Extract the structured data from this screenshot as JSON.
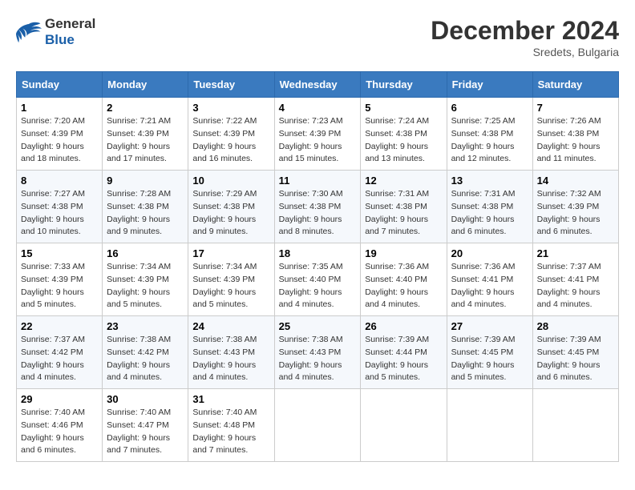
{
  "header": {
    "logo_line1": "General",
    "logo_line2": "Blue",
    "month_title": "December 2024",
    "location": "Sredets, Bulgaria"
  },
  "weekdays": [
    "Sunday",
    "Monday",
    "Tuesday",
    "Wednesday",
    "Thursday",
    "Friday",
    "Saturday"
  ],
  "weeks": [
    [
      {
        "day": "1",
        "sunrise": "7:20 AM",
        "sunset": "4:39 PM",
        "daylight": "9 hours and 18 minutes."
      },
      {
        "day": "2",
        "sunrise": "7:21 AM",
        "sunset": "4:39 PM",
        "daylight": "9 hours and 17 minutes."
      },
      {
        "day": "3",
        "sunrise": "7:22 AM",
        "sunset": "4:39 PM",
        "daylight": "9 hours and 16 minutes."
      },
      {
        "day": "4",
        "sunrise": "7:23 AM",
        "sunset": "4:39 PM",
        "daylight": "9 hours and 15 minutes."
      },
      {
        "day": "5",
        "sunrise": "7:24 AM",
        "sunset": "4:38 PM",
        "daylight": "9 hours and 13 minutes."
      },
      {
        "day": "6",
        "sunrise": "7:25 AM",
        "sunset": "4:38 PM",
        "daylight": "9 hours and 12 minutes."
      },
      {
        "day": "7",
        "sunrise": "7:26 AM",
        "sunset": "4:38 PM",
        "daylight": "9 hours and 11 minutes."
      }
    ],
    [
      {
        "day": "8",
        "sunrise": "7:27 AM",
        "sunset": "4:38 PM",
        "daylight": "9 hours and 10 minutes."
      },
      {
        "day": "9",
        "sunrise": "7:28 AM",
        "sunset": "4:38 PM",
        "daylight": "9 hours and 9 minutes."
      },
      {
        "day": "10",
        "sunrise": "7:29 AM",
        "sunset": "4:38 PM",
        "daylight": "9 hours and 9 minutes."
      },
      {
        "day": "11",
        "sunrise": "7:30 AM",
        "sunset": "4:38 PM",
        "daylight": "9 hours and 8 minutes."
      },
      {
        "day": "12",
        "sunrise": "7:31 AM",
        "sunset": "4:38 PM",
        "daylight": "9 hours and 7 minutes."
      },
      {
        "day": "13",
        "sunrise": "7:31 AM",
        "sunset": "4:38 PM",
        "daylight": "9 hours and 6 minutes."
      },
      {
        "day": "14",
        "sunrise": "7:32 AM",
        "sunset": "4:39 PM",
        "daylight": "9 hours and 6 minutes."
      }
    ],
    [
      {
        "day": "15",
        "sunrise": "7:33 AM",
        "sunset": "4:39 PM",
        "daylight": "9 hours and 5 minutes."
      },
      {
        "day": "16",
        "sunrise": "7:34 AM",
        "sunset": "4:39 PM",
        "daylight": "9 hours and 5 minutes."
      },
      {
        "day": "17",
        "sunrise": "7:34 AM",
        "sunset": "4:39 PM",
        "daylight": "9 hours and 5 minutes."
      },
      {
        "day": "18",
        "sunrise": "7:35 AM",
        "sunset": "4:40 PM",
        "daylight": "9 hours and 4 minutes."
      },
      {
        "day": "19",
        "sunrise": "7:36 AM",
        "sunset": "4:40 PM",
        "daylight": "9 hours and 4 minutes."
      },
      {
        "day": "20",
        "sunrise": "7:36 AM",
        "sunset": "4:41 PM",
        "daylight": "9 hours and 4 minutes."
      },
      {
        "day": "21",
        "sunrise": "7:37 AM",
        "sunset": "4:41 PM",
        "daylight": "9 hours and 4 minutes."
      }
    ],
    [
      {
        "day": "22",
        "sunrise": "7:37 AM",
        "sunset": "4:42 PM",
        "daylight": "9 hours and 4 minutes."
      },
      {
        "day": "23",
        "sunrise": "7:38 AM",
        "sunset": "4:42 PM",
        "daylight": "9 hours and 4 minutes."
      },
      {
        "day": "24",
        "sunrise": "7:38 AM",
        "sunset": "4:43 PM",
        "daylight": "9 hours and 4 minutes."
      },
      {
        "day": "25",
        "sunrise": "7:38 AM",
        "sunset": "4:43 PM",
        "daylight": "9 hours and 4 minutes."
      },
      {
        "day": "26",
        "sunrise": "7:39 AM",
        "sunset": "4:44 PM",
        "daylight": "9 hours and 5 minutes."
      },
      {
        "day": "27",
        "sunrise": "7:39 AM",
        "sunset": "4:45 PM",
        "daylight": "9 hours and 5 minutes."
      },
      {
        "day": "28",
        "sunrise": "7:39 AM",
        "sunset": "4:45 PM",
        "daylight": "9 hours and 6 minutes."
      }
    ],
    [
      {
        "day": "29",
        "sunrise": "7:40 AM",
        "sunset": "4:46 PM",
        "daylight": "9 hours and 6 minutes."
      },
      {
        "day": "30",
        "sunrise": "7:40 AM",
        "sunset": "4:47 PM",
        "daylight": "9 hours and 7 minutes."
      },
      {
        "day": "31",
        "sunrise": "7:40 AM",
        "sunset": "4:48 PM",
        "daylight": "9 hours and 7 minutes."
      },
      null,
      null,
      null,
      null
    ]
  ],
  "labels": {
    "sunrise": "Sunrise:",
    "sunset": "Sunset:",
    "daylight": "Daylight:"
  }
}
